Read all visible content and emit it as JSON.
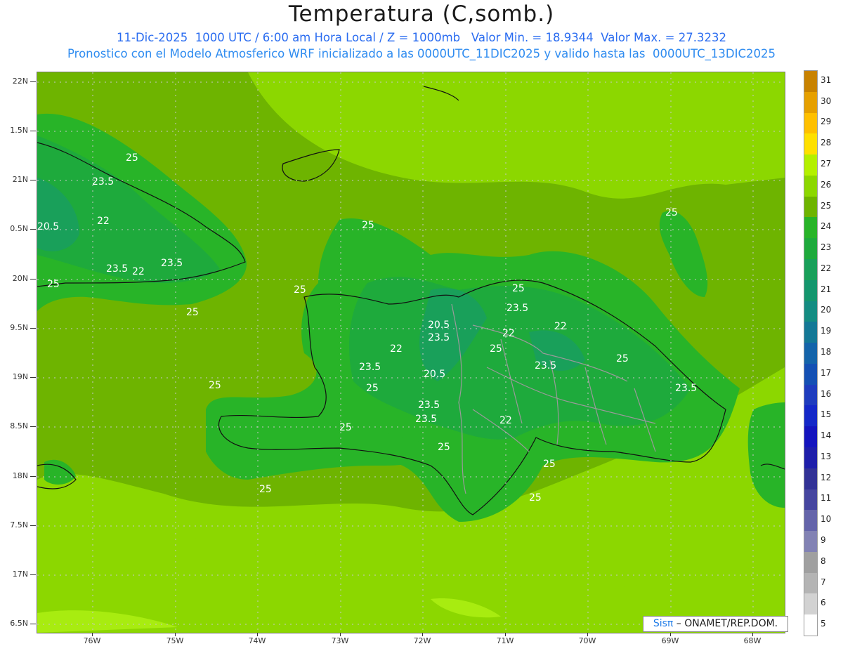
{
  "title": "Temperatura (C,somb.)",
  "subtitle_line1": "11-Dic-2025  1000 UTC / 6:00 am Hora Local / Z = 1000mb   Valor Min. = 18.9344  Valor Max. = 27.3232",
  "subtitle_line2": "Pronostico con el Modelo Atmosferico WRF inicializado a las 0000UTC_11DIC2025 y valido hasta las  0000UTC_13DIC2025",
  "lat_labels": [
    "22N",
    "1.5N",
    "21N",
    "0.5N",
    "20N",
    "9.5N",
    "19N",
    "8.5N",
    "18N",
    "7.5N",
    "17N",
    "6.5N"
  ],
  "lon_labels": [
    "76W",
    "75W",
    "74W",
    "73W",
    "72W",
    "71W",
    "70W",
    "69W",
    "68W"
  ],
  "colorbar": {
    "labels": [
      "31",
      "30",
      "29",
      "28",
      "27",
      "26",
      "25",
      "24",
      "23",
      "22",
      "21",
      "20",
      "19",
      "18",
      "17",
      "16",
      "15",
      "14",
      "13",
      "12",
      "11",
      "10",
      "9",
      "8",
      "7",
      "6",
      "5"
    ],
    "colors": [
      "#c88200",
      "#e6a000",
      "#ffc000",
      "#ffe000",
      "#b4f000",
      "#8cd700",
      "#6eb400",
      "#28b428",
      "#1eaa3c",
      "#19a05a",
      "#14966e",
      "#148c82",
      "#147896",
      "#1464aa",
      "#1450b4",
      "#1e3cbe",
      "#1428c8",
      "#1414be",
      "#1e1eaa",
      "#323296",
      "#4646a0",
      "#6464aa",
      "#8282b4",
      "#a0a0a0",
      "#b4b4b4",
      "#d2d2d2",
      "#ffffff"
    ]
  },
  "contour_labels": [
    "25",
    "23.5",
    "22",
    "20.5",
    "23.5",
    "22",
    "23.5",
    "25",
    "25",
    "25",
    "25",
    "25",
    "23.5",
    "22",
    "20.5",
    "23.5",
    "22",
    "25",
    "23.5",
    "20.5",
    "25",
    "23.5",
    "22",
    "25",
    "23.5",
    "23.5",
    "25",
    "25",
    "25",
    "25",
    "25",
    "23.5",
    "22",
    "25",
    "25"
  ],
  "credit": {
    "brand": "Sisπ",
    "org": " – ONAMET/REP.DOM."
  }
}
